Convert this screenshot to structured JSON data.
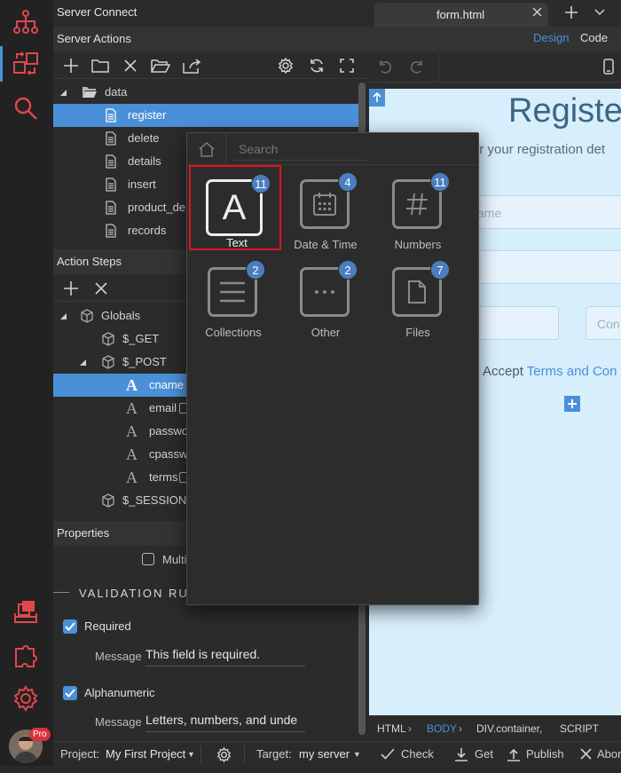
{
  "left_icons": [
    "sitemap-icon",
    "server-actions-icon",
    "search-icon",
    "deploy-icon",
    "extensions-icon",
    "settings-icon",
    "user-avatar"
  ],
  "avatar_badge": "Pro",
  "server_connect": {
    "title": "Server Connect"
  },
  "server_actions": {
    "title": "Server Actions",
    "toolbar": [
      "add-icon",
      "folder-icon",
      "delete-icon",
      "open-folder-icon",
      "export-icon",
      "gear-icon",
      "refresh-icon",
      "expand-icon"
    ],
    "folder": "data",
    "items": [
      "register",
      "delete",
      "details",
      "insert",
      "product_de",
      "records"
    ],
    "selected": "register"
  },
  "action_steps": {
    "title": "Action Steps",
    "globals": "Globals",
    "get": "$_GET",
    "post": "$_POST",
    "fields": [
      "cname",
      "email",
      "passwo",
      "cpassw",
      "terms"
    ],
    "selected": "cname",
    "session": "$_SESSION"
  },
  "properties": {
    "title": "Properties",
    "multi_label": "Multi",
    "validation_header": "VALIDATION RU",
    "rules": [
      {
        "label": "Required",
        "message_label": "Message",
        "message": "This field is required."
      },
      {
        "label": "Alphanumeric",
        "message_label": "Message",
        "message": "Letters, numbers, and unde"
      }
    ]
  },
  "statusbar": {
    "project_label": "Project:",
    "project_value": "My First Project",
    "target_label": "Target:",
    "target_value": "my server",
    "check": "Check",
    "get": "Get",
    "publish": "Publish",
    "abort": "Abor"
  },
  "editor": {
    "tab": "form.html",
    "design": "Design",
    "code": "Code",
    "heading": "Registe",
    "subtitle": "er your registration det",
    "name_placeholder": "ame",
    "confirm_placeholder": "Con",
    "accept_text": "Accept",
    "terms_link": "Terms and Con",
    "breadcrumb": [
      "HTML",
      "BODY",
      "DIV.container,",
      "SCRIPT"
    ]
  },
  "picker": {
    "search_placeholder": "Search",
    "tiles": [
      {
        "label": "Text",
        "count": "11",
        "icon": "text-icon"
      },
      {
        "label": "Date & Time",
        "count": "4",
        "icon": "calendar-icon"
      },
      {
        "label": "Numbers",
        "count": "11",
        "icon": "hash-icon"
      },
      {
        "label": "Collections",
        "count": "2",
        "icon": "list-icon"
      },
      {
        "label": "Other",
        "count": "2",
        "icon": "ellipsis-icon"
      },
      {
        "label": "Files",
        "count": "7",
        "icon": "file-icon"
      }
    ],
    "selected": "Text"
  },
  "colors": {
    "accent": "#4a90d9",
    "badge": "#4a7ec0",
    "highlight": "#e0141e",
    "canvas": "#d7eefc"
  }
}
